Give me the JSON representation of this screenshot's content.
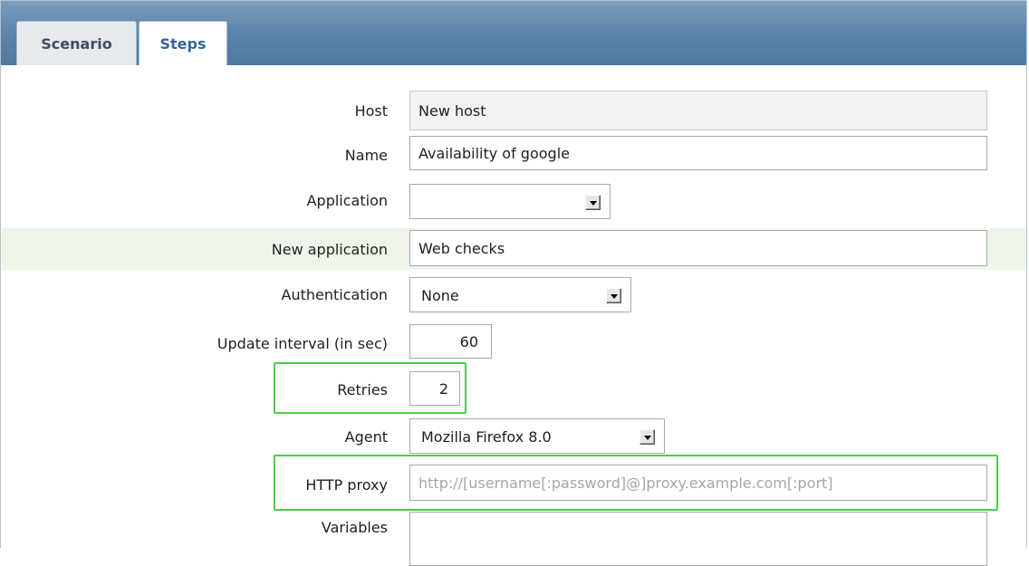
{
  "tabs": [
    {
      "label": "Scenario",
      "active": true
    },
    {
      "label": "Steps",
      "active": false
    }
  ],
  "form": {
    "host": {
      "label": "Host",
      "value": "New host"
    },
    "name": {
      "label": "Name",
      "value": "Availability of google"
    },
    "application": {
      "label": "Application",
      "value": ""
    },
    "new_application": {
      "label": "New application",
      "value": "Web checks"
    },
    "authentication": {
      "label": "Authentication",
      "value": "None"
    },
    "update_interval": {
      "label": "Update interval (in sec)",
      "value": "60"
    },
    "retries": {
      "label": "Retries",
      "value": "2"
    },
    "agent": {
      "label": "Agent",
      "value": "Mozilla Firefox 8.0"
    },
    "http_proxy": {
      "label": "HTTP proxy",
      "value": "",
      "placeholder": "http://[username[:password]@]proxy.example.com[:port]"
    },
    "variables": {
      "label": "Variables",
      "value": ""
    }
  },
  "colors": {
    "header": "#5f86ab",
    "highlight_row": "#eef6ea",
    "annotation_box": "#4ccd4c"
  },
  "icons": [
    "dropdown-arrow-icon"
  ]
}
